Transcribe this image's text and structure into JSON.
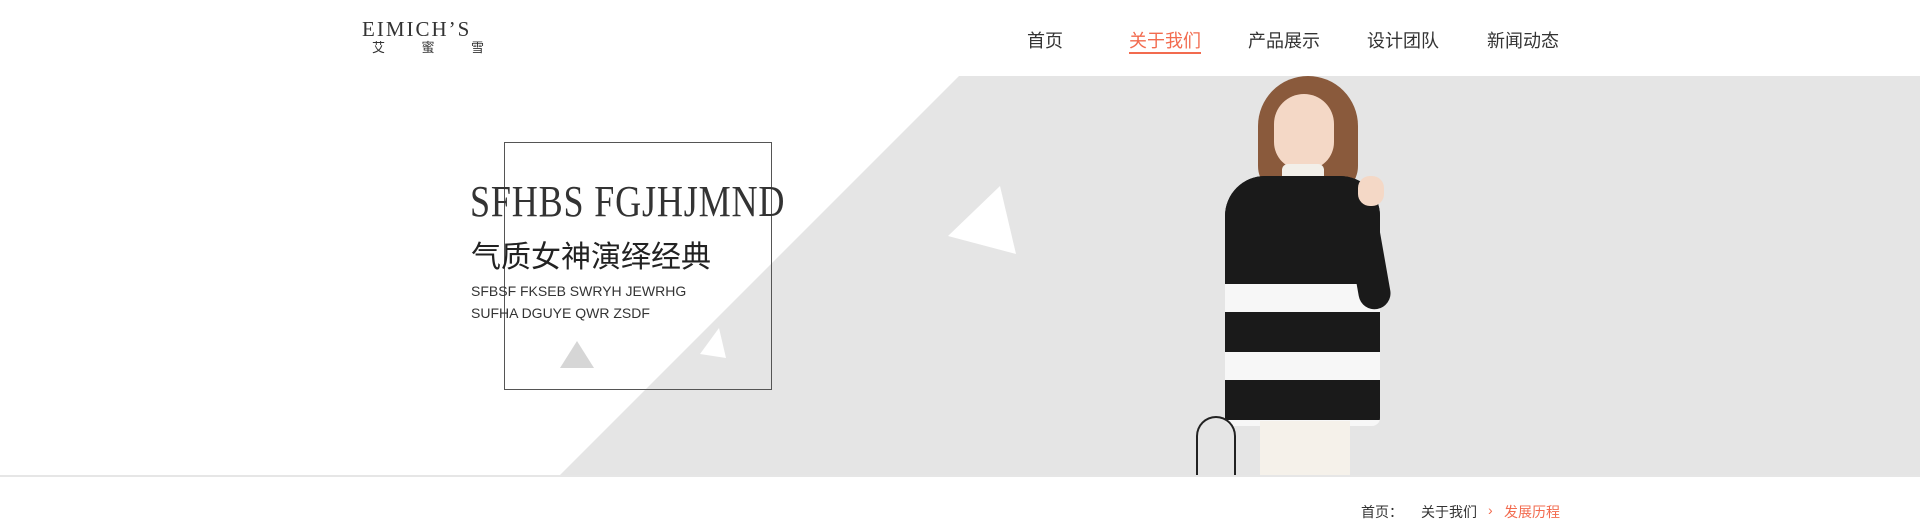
{
  "logo": {
    "en": "EIMICH’S",
    "cn": [
      "艾",
      "蜜",
      "雪"
    ]
  },
  "nav": {
    "items": [
      {
        "label": "首页",
        "active": false
      },
      {
        "label": "关于我们",
        "active": true
      },
      {
        "label": "产品展示",
        "active": false
      },
      {
        "label": "设计团队",
        "active": false
      },
      {
        "label": "新闻动态",
        "active": false
      }
    ]
  },
  "banner": {
    "title_en": "SFHBS FGJHJMND",
    "title_cn": "气质女神演绎经典",
    "sub_line_1": "SFBSF FKSEB SWRYH JEWRHG",
    "sub_line_2": "SUFHA DGUYE QWR  ZSDF"
  },
  "breadcrumb": {
    "home": "首页：",
    "parent": "关于我们",
    "separator": "›",
    "current": "发展历程"
  },
  "colors": {
    "accent": "#f26b4f",
    "banner_gray": "#e5e5e5",
    "text": "#333333"
  }
}
